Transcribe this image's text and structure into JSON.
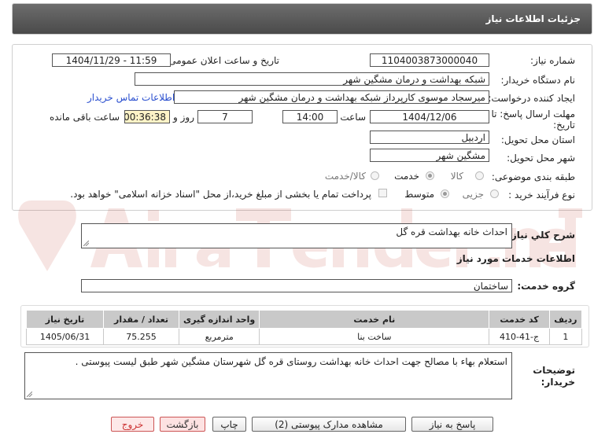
{
  "header": {
    "title": "جزئیات اطلاعات نیاز"
  },
  "form": {
    "need_number_label": "شماره نیاز:",
    "need_number": "1104003873000040",
    "announce_label": "تاریخ و ساعت اعلان عمومی:",
    "announce_value": "1404/11/29 - 11:59",
    "buyer_org_label": "نام دستگاه خریدار:",
    "buyer_org": "شبکه بهداشت و درمان مشگین شهر",
    "creator_label": "ایجاد کننده درخواست:",
    "creator": "میرسجاد موسوی کارپرداز شبکه بهداشت و درمان مشگین شهر",
    "contact_link": "اطلاعات تماس خریدار",
    "deadline_label_1": "مهلت ارسال پاسخ: تا",
    "deadline_label_2": "تاریخ:",
    "deadline_date": "1404/12/06",
    "time_label": "ساعت",
    "deadline_time": "14:00",
    "days_value": "7",
    "days_label": "روز و",
    "remaining_time": "00:36:38",
    "remaining_label": "ساعت باقی مانده",
    "province_label": "استان محل تحویل:",
    "province": "اردبیل",
    "city_label": "شهر محل تحویل:",
    "city": "مشگین شهر",
    "category_label": "طبقه بندی موضوعی:",
    "category_options": [
      "کالا",
      "خدمت",
      "کالا/خدمت"
    ],
    "category_selected": "خدمت",
    "process_label": "نوع فرآیند خرید :",
    "process_options": [
      "جزیی",
      "متوسط"
    ],
    "process_selected": "متوسط",
    "payment_note": "پرداخت تمام یا بخشی از مبلغ خرید،از محل \"اسناد خزانه اسلامی\" خواهد بود."
  },
  "summary": {
    "label": "شرح کلي نياز:",
    "value": "احداث خانه بهداشت قره گل"
  },
  "services": {
    "section_title": "اطلاعات خدمات مورد نیاز",
    "group_label": "گروه خدمت:",
    "group_value": "ساختمان",
    "columns": [
      "ردیف",
      "کد خدمت",
      "نام خدمت",
      "واحد اندازه گیری",
      "تعداد / مقدار",
      "تاریخ نیاز"
    ],
    "rows": [
      [
        "1",
        "ج-41-410",
        "ساخت بنا",
        "مترمربع",
        "75.255",
        "1405/06/31"
      ]
    ]
  },
  "buyer_notes": {
    "label_1": "توضیحات",
    "label_2": "خریدار:",
    "value": "استعلام بهاء با مصالح جهت احداث خانه بهداشت روستای قره گل شهرستان مشگین شهر طبق لیست پیوستی ."
  },
  "buttons": {
    "reply": "پاسخ به نیاز",
    "attachments": "مشاهده مدارک پیوستی (2)",
    "print": "چاپ",
    "back": "بازگشت",
    "exit": "خروج"
  },
  "watermark": {
    "text": "AriaTender.net"
  },
  "colors": {
    "header_bg": "#5a5a5a",
    "link": "#2a4fcf",
    "timer_bg": "#fdf3c7",
    "table_head": "#c9c9c9"
  }
}
